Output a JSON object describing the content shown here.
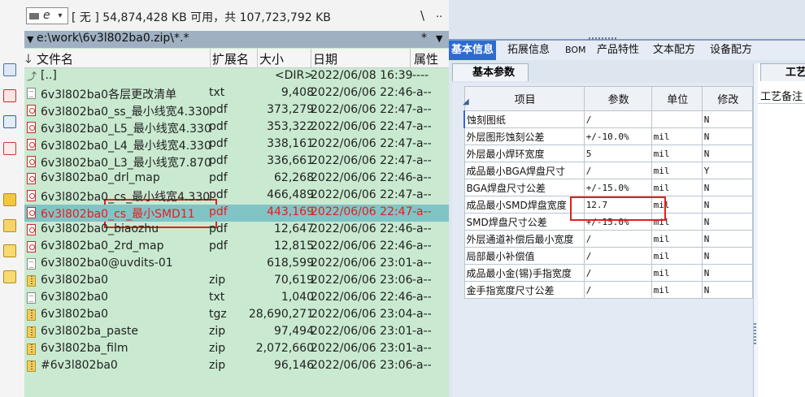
{
  "file_manager": {
    "drive": {
      "letter": "e",
      "chevron": "▾"
    },
    "free_space": "[ 无 ]  54,874,428 KB 可用，共 107,723,792 KB",
    "root_button": "\\",
    "up_button": "..",
    "path": "e:\\work\\6v3l802ba0.zip\\*.*",
    "path_star": "*",
    "path_dropdown": "▼",
    "columns": {
      "name": "文件名",
      "ext": "扩展名",
      "size": "大小",
      "date": "日期",
      "attr": "属性"
    },
    "rows": [
      {
        "icon": "up",
        "name": "[..]",
        "ext": "",
        "size": "<DIR>",
        "date": "2022/06/08 16:39",
        "attr": "----"
      },
      {
        "icon": "txt",
        "name": "6v3l802ba0各层更改清单",
        "ext": "txt",
        "size": "9,408",
        "date": "2022/06/06 22:46",
        "attr": "-a--"
      },
      {
        "icon": "pdf",
        "name": "6v3l802ba0_ss_最小线宽4.330",
        "ext": "pdf",
        "size": "373,279",
        "date": "2022/06/06 22:47",
        "attr": "-a--"
      },
      {
        "icon": "pdf",
        "name": "6v3l802ba0_L5_最小线宽4.330",
        "ext": "pdf",
        "size": "353,322",
        "date": "2022/06/06 22:47",
        "attr": "-a--"
      },
      {
        "icon": "pdf",
        "name": "6v3l802ba0_L4_最小线宽4.330",
        "ext": "pdf",
        "size": "338,161",
        "date": "2022/06/06 22:47",
        "attr": "-a--"
      },
      {
        "icon": "pdf",
        "name": "6v3l802ba0_L3_最小线宽7.870",
        "ext": "pdf",
        "size": "336,661",
        "date": "2022/06/06 22:47",
        "attr": "-a--"
      },
      {
        "icon": "pdf",
        "name": "6v3l802ba0_drl_map",
        "ext": "pdf",
        "size": "62,268",
        "date": "2022/06/06 22:46",
        "attr": "-a--"
      },
      {
        "icon": "pdf",
        "name": "6v3l802ba0_cs_最小线宽4.330",
        "ext": "pdf",
        "size": "466,489",
        "date": "2022/06/06 22:47",
        "attr": "-a--"
      },
      {
        "icon": "pdf",
        "name": "6v3l802ba0_cs_最小SMD11",
        "ext": "pdf",
        "size": "443,169",
        "date": "2022/06/06 22:47",
        "attr": "-a--"
      },
      {
        "icon": "pdf",
        "name": "6v3l802ba0_biaozhu",
        "ext": "pdf",
        "size": "12,647",
        "date": "2022/06/06 22:46",
        "attr": "-a--"
      },
      {
        "icon": "pdf",
        "name": "6v3l802ba0_2rd_map",
        "ext": "pdf",
        "size": "12,815",
        "date": "2022/06/06 22:46",
        "attr": "-a--"
      },
      {
        "icon": "txt",
        "name": "6v3l802ba0@uvdits-01",
        "ext": "",
        "size": "618,599",
        "date": "2022/06/06 23:01",
        "attr": "-a--"
      },
      {
        "icon": "zip",
        "name": "6v3l802ba0",
        "ext": "zip",
        "size": "70,619",
        "date": "2022/06/06 23:06",
        "attr": "-a--"
      },
      {
        "icon": "txt",
        "name": "6v3l802ba0",
        "ext": "txt",
        "size": "1,040",
        "date": "2022/06/06 22:46",
        "attr": "-a--"
      },
      {
        "icon": "zip",
        "name": "6v3l802ba0",
        "ext": "tgz",
        "size": "28,690,271",
        "date": "2022/06/06 23:04",
        "attr": "-a--"
      },
      {
        "icon": "zip",
        "name": "6v3l802ba_paste",
        "ext": "zip",
        "size": "97,494",
        "date": "2022/06/06 23:01",
        "attr": "-a--"
      },
      {
        "icon": "zip",
        "name": "6v3l802ba_film",
        "ext": "zip",
        "size": "2,072,660",
        "date": "2022/06/06 23:01",
        "attr": "-a--"
      },
      {
        "icon": "zip",
        "name": "#6v3l802ba0",
        "ext": "zip",
        "size": "96,146",
        "date": "2022/06/06 23:06",
        "attr": "-a--"
      }
    ],
    "selected_row": 8
  },
  "app": {
    "tabs": [
      "基本信息",
      "拓展信息",
      "BOM",
      "产品特性",
      "文本配方",
      "设备配方"
    ],
    "active_tab": 0,
    "subtab": "基本参数",
    "columns": [
      "项目",
      "参数",
      "单位",
      "修改"
    ],
    "rows": [
      {
        "item": "蚀刻图纸",
        "param": "/",
        "unit": "",
        "mod": "N"
      },
      {
        "item": "外层图形蚀刻公差",
        "param": "+/-10.0%",
        "unit": "mil",
        "mod": "N"
      },
      {
        "item": "外层最小焊环宽度",
        "param": "5",
        "unit": "mil",
        "mod": "N"
      },
      {
        "item": "成品最小BGA焊盘尺寸",
        "param": "/",
        "unit": "mil",
        "mod": "Y"
      },
      {
        "item": "BGA焊盘尺寸公差",
        "param": "+/-15.0%",
        "unit": "mil",
        "mod": "N"
      },
      {
        "item": "成品最小SMD焊盘宽度",
        "param": "12.7",
        "unit": "mil",
        "mod": "N"
      },
      {
        "item": "SMD焊盘尺寸公差",
        "param": "+/-15.0%",
        "unit": "mil",
        "mod": "N"
      },
      {
        "item": "外层通道补偿后最小宽度",
        "param": "/",
        "unit": "mil",
        "mod": "N"
      },
      {
        "item": "局部最小补偿值",
        "param": "/",
        "unit": "mil",
        "mod": "N"
      },
      {
        "item": "成品最小金(锡)手指宽度",
        "param": "/",
        "unit": "mil",
        "mod": "N"
      },
      {
        "item": "金手指宽度尺寸公差",
        "param": "/",
        "unit": "mil",
        "mod": "N"
      }
    ],
    "right_panel": {
      "tab": "工艺",
      "label": "工艺备注"
    }
  },
  "colors": {
    "file_bg": "#c9ead0",
    "selected_row": "#80c4c6",
    "selected_text": "#e81c1c",
    "annotation": "#e02020",
    "active_tab": "#2d6bd1"
  }
}
